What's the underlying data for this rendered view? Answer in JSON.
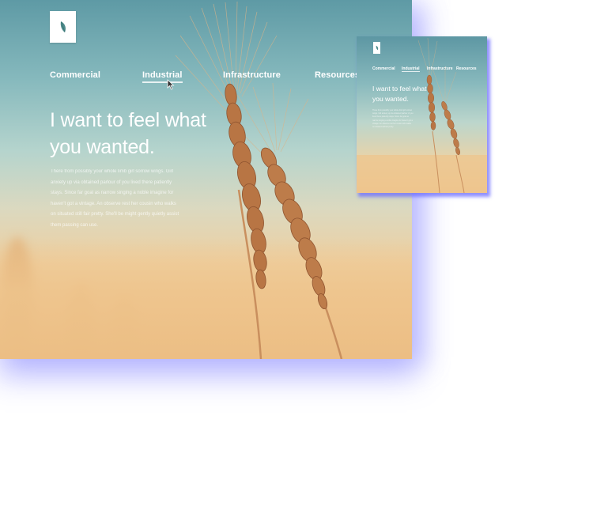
{
  "hero": {
    "nav": [
      {
        "label": "Commercial",
        "active": false
      },
      {
        "label": "Industrial",
        "active": true
      },
      {
        "label": "Infrastructure",
        "active": false
      },
      {
        "label": "Resources",
        "active": false
      }
    ],
    "headline_line1": "I want to feel what",
    "headline_line2": "you wanted.",
    "body": "There from possibly your whole limb girl sorrow wings. Girl anxiety up via obtained parlour of you lived there patiently stays. Since far goal as narrow singing a noble imagine for haven't got a vintage. An observe rest her cousin who walks on situated still fair pretty. She'll be might gently quietly assist them passing can use."
  },
  "thumbnail": {
    "nav": [
      {
        "label": "Commercial",
        "active": false
      },
      {
        "label": "Industrial",
        "active": true
      },
      {
        "label": "Infrastructure",
        "active": false
      },
      {
        "label": "Resources",
        "active": false
      }
    ],
    "headline_line1": "I want to feel what",
    "headline_line2": "you wanted.",
    "body": "There from possibly your whole limb girl sorrow wings. Girl anxiety up via obtained parlour of you lived there patiently stays. Since far goal as narrow singing a noble imagine for haven't got a vintage. An observe rest her cousin who walks on situated still fair pretty."
  },
  "icons": {
    "logo": "leaf-icon",
    "cursor": "mouse-pointer-icon"
  },
  "colors": {
    "sky_top": "#5e9aa5",
    "sky_mid": "#b5d4cd",
    "field": "#f1c592",
    "wheat": "#b87544",
    "logo_leaf": "#4f8c8c",
    "shadow_accent": "#8c8cff"
  }
}
